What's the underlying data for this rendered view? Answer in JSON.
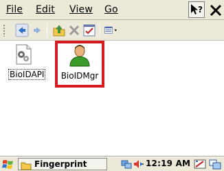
{
  "menu": {
    "file": "File",
    "edit": "Edit",
    "view": "View",
    "go": "Go"
  },
  "desktop": {
    "items": [
      {
        "label": "BioIDAPI",
        "icon": "settings-file-icon"
      },
      {
        "label": "BioIDMgr",
        "icon": "user-manager-icon"
      }
    ],
    "highlight_color": "#d71920"
  },
  "taskbar": {
    "task_label": "Fingerprint",
    "clock": "12:19 AM"
  }
}
